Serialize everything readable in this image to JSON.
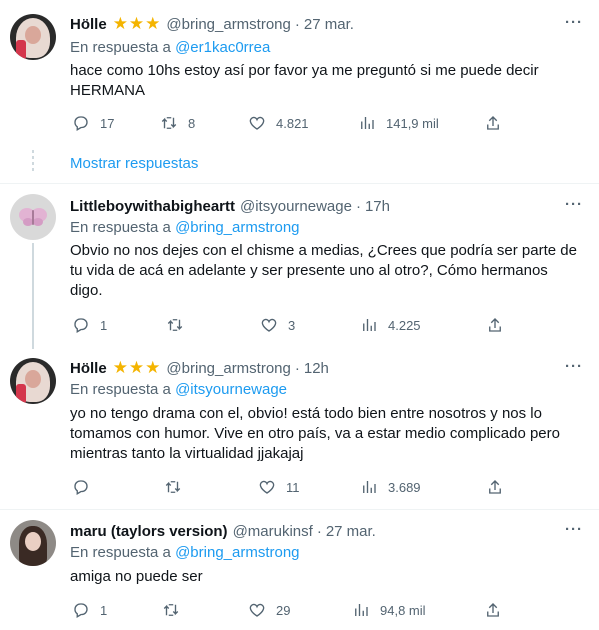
{
  "tweets": [
    {
      "name": "Hölle",
      "stars": "★★★",
      "handle": "@bring_armstrong",
      "time": "27 mar.",
      "reply_prefix": "En respuesta a",
      "reply_to": "@er1kac0rrea",
      "text": "hace como 10hs estoy así por favor ya me preguntó si me puede decir HERMANA",
      "replies": "17",
      "retweets": "8",
      "likes": "4.821",
      "views": "141,9 mil"
    },
    {
      "name": "Littleboywithabigheartt",
      "stars": "",
      "handle": "@itsyournewage",
      "time": "17h",
      "reply_prefix": "En respuesta a",
      "reply_to": "@bring_armstrong",
      "text": "Obvio no nos dejes con el chisme a medias, ¿Crees que podría ser parte de tu vida de acá en adelante y ser presente uno al otro?, Cómo hermanos digo.",
      "replies": "1",
      "retweets": "",
      "likes": "3",
      "views": "4.225"
    },
    {
      "name": "Hölle",
      "stars": "★★★",
      "handle": "@bring_armstrong",
      "time": "12h",
      "reply_prefix": "En respuesta a",
      "reply_to": "@itsyournewage",
      "text": "yo no tengo drama con el, obvio! está todo bien entre nosotros y nos lo tomamos con humor. Vive en otro país, va a estar medio complicado pero mientras tanto la virtualidad jjakajaj",
      "replies": "",
      "retweets": "",
      "likes": "11",
      "views": "3.689"
    },
    {
      "name": "maru (taylors version)",
      "stars": "",
      "handle": "@marukinsf",
      "time": "27 mar.",
      "reply_prefix": "En respuesta a",
      "reply_to": "@bring_armstrong",
      "text": "amiga no puede ser",
      "replies": "1",
      "retweets": "",
      "likes": "29",
      "views": "94,8 mil"
    }
  ],
  "show_replies": "Mostrar respuestas",
  "icons": {
    "more": "more-icon",
    "reply": "reply-icon",
    "retweet": "retweet-icon",
    "like": "heart-icon",
    "views": "views-icon",
    "share": "share-icon"
  },
  "colors": {
    "link": "#1d9bf0",
    "muted": "#536471",
    "star": "#f4b400"
  }
}
